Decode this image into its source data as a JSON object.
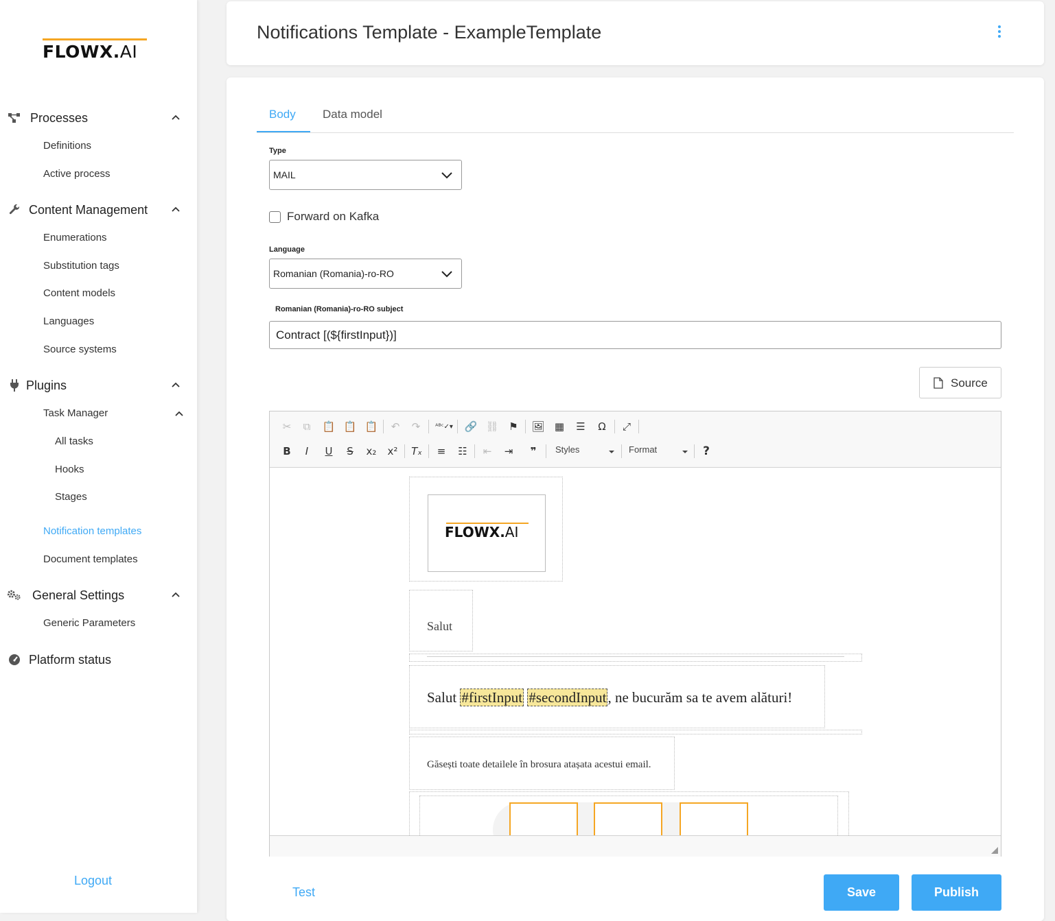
{
  "sidebar": {
    "logo": {
      "main": "FLOWX",
      "dot": ".",
      "suffix": "AI"
    },
    "sections": {
      "processes": {
        "label": "Processes",
        "icon": "processes-icon",
        "items": [
          "Definitions",
          "Active process"
        ]
      },
      "content_management": {
        "label": "Content Management",
        "icon": "wrench-icon",
        "items": [
          "Enumerations",
          "Substitution tags",
          "Content models",
          "Languages",
          "Source systems"
        ]
      },
      "plugins": {
        "label": "Plugins",
        "icon": "plug-icon",
        "task_manager": {
          "label": "Task Manager",
          "items": [
            "All tasks",
            "Hooks",
            "Stages"
          ]
        },
        "items": [
          "Notification templates",
          "Document templates"
        ]
      },
      "general_settings": {
        "label": "General Settings",
        "icon": "gears-icon",
        "items": [
          "Generic Parameters"
        ]
      },
      "platform_status": {
        "label": "Platform status",
        "icon": "gauge-icon"
      }
    },
    "active_item": "Notification templates",
    "logout": "Logout"
  },
  "header": {
    "title": "Notifications Template - ExampleTemplate"
  },
  "tabs": [
    {
      "label": "Body",
      "active": true
    },
    {
      "label": "Data model",
      "active": false
    }
  ],
  "form": {
    "type": {
      "label": "Type",
      "value": "MAIL"
    },
    "forward_kafka": {
      "label": "Forward on Kafka",
      "checked": false
    },
    "language": {
      "label": "Language",
      "value": "Romanian (Romania)-ro-RO"
    },
    "subject": {
      "label": "Romanian (Romania)-ro-RO subject",
      "value": "Contract [(${firstInput})]"
    },
    "source_button": "Source"
  },
  "editor": {
    "toolbar": {
      "styles_label": "Styles",
      "format_label": "Format"
    },
    "content": {
      "logo": {
        "main": "FLOWX",
        "dot": ".",
        "suffix": "AI"
      },
      "greeting": "Salut",
      "line_prefix": "Salut ",
      "tag_first": "#firstInput",
      "tag_second": "#secondInput",
      "line_suffix": ", ne bucurăm sa te avem alături!",
      "details": "Găsești toate detailele în brosura atașata acestui email."
    }
  },
  "footer": {
    "test": "Test",
    "save": "Save",
    "publish": "Publish"
  },
  "colors": {
    "accent": "#3fa9f5",
    "brand_orange": "#f5a623",
    "tag_highlight": "#f7e79a"
  }
}
